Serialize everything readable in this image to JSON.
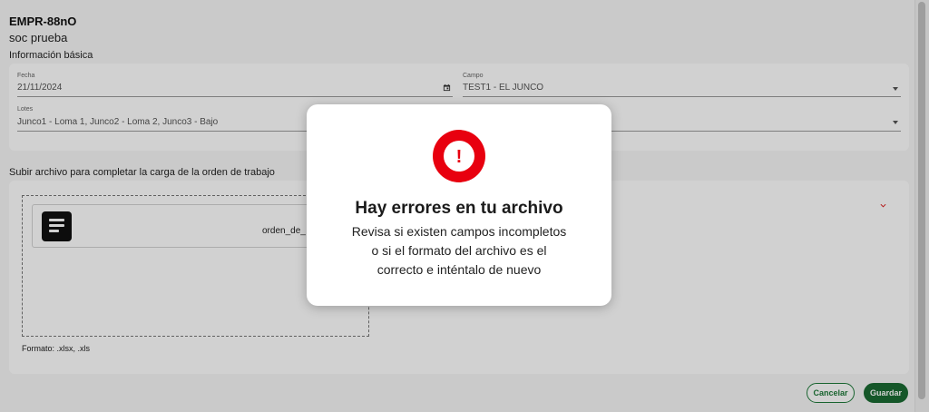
{
  "header": {
    "code": "EMPR-88nO",
    "company": "soc prueba"
  },
  "basic_info": {
    "section_label": "Información básica",
    "fecha": {
      "label": "Fecha",
      "value": "21/11/2024"
    },
    "campo": {
      "label": "Campo",
      "value": "TEST1 - EL JUNCO"
    },
    "lotes": {
      "label": "Lotes",
      "value": "Junco1 - Loma 1, Junco2 - Loma 2, Junco3 - Bajo"
    }
  },
  "upload": {
    "section_label": "Subir archivo para completar la carga de la orden de trabajo",
    "file_name": "orden_de_",
    "format_note": "Formato: .xlsx, .xls"
  },
  "actions": {
    "cancel_label": "Cancelar",
    "save_label": "Guardar"
  },
  "modal": {
    "title": "Hay errores en tu archivo",
    "lines": [
      "Revisa si existen campos incompletos",
      "o si el formato del archivo es el",
      "correcto e inténtalo de nuevo"
    ],
    "icon_mark": "!",
    "accent_color": "#e8000f"
  },
  "icons": {
    "calendar": "calendar-icon",
    "document": "document-icon",
    "alert": "alert-circle-icon",
    "chevron": "chevron-down-icon"
  },
  "colors": {
    "primary_green": "#1a6b32",
    "error_red": "#e8000f"
  }
}
